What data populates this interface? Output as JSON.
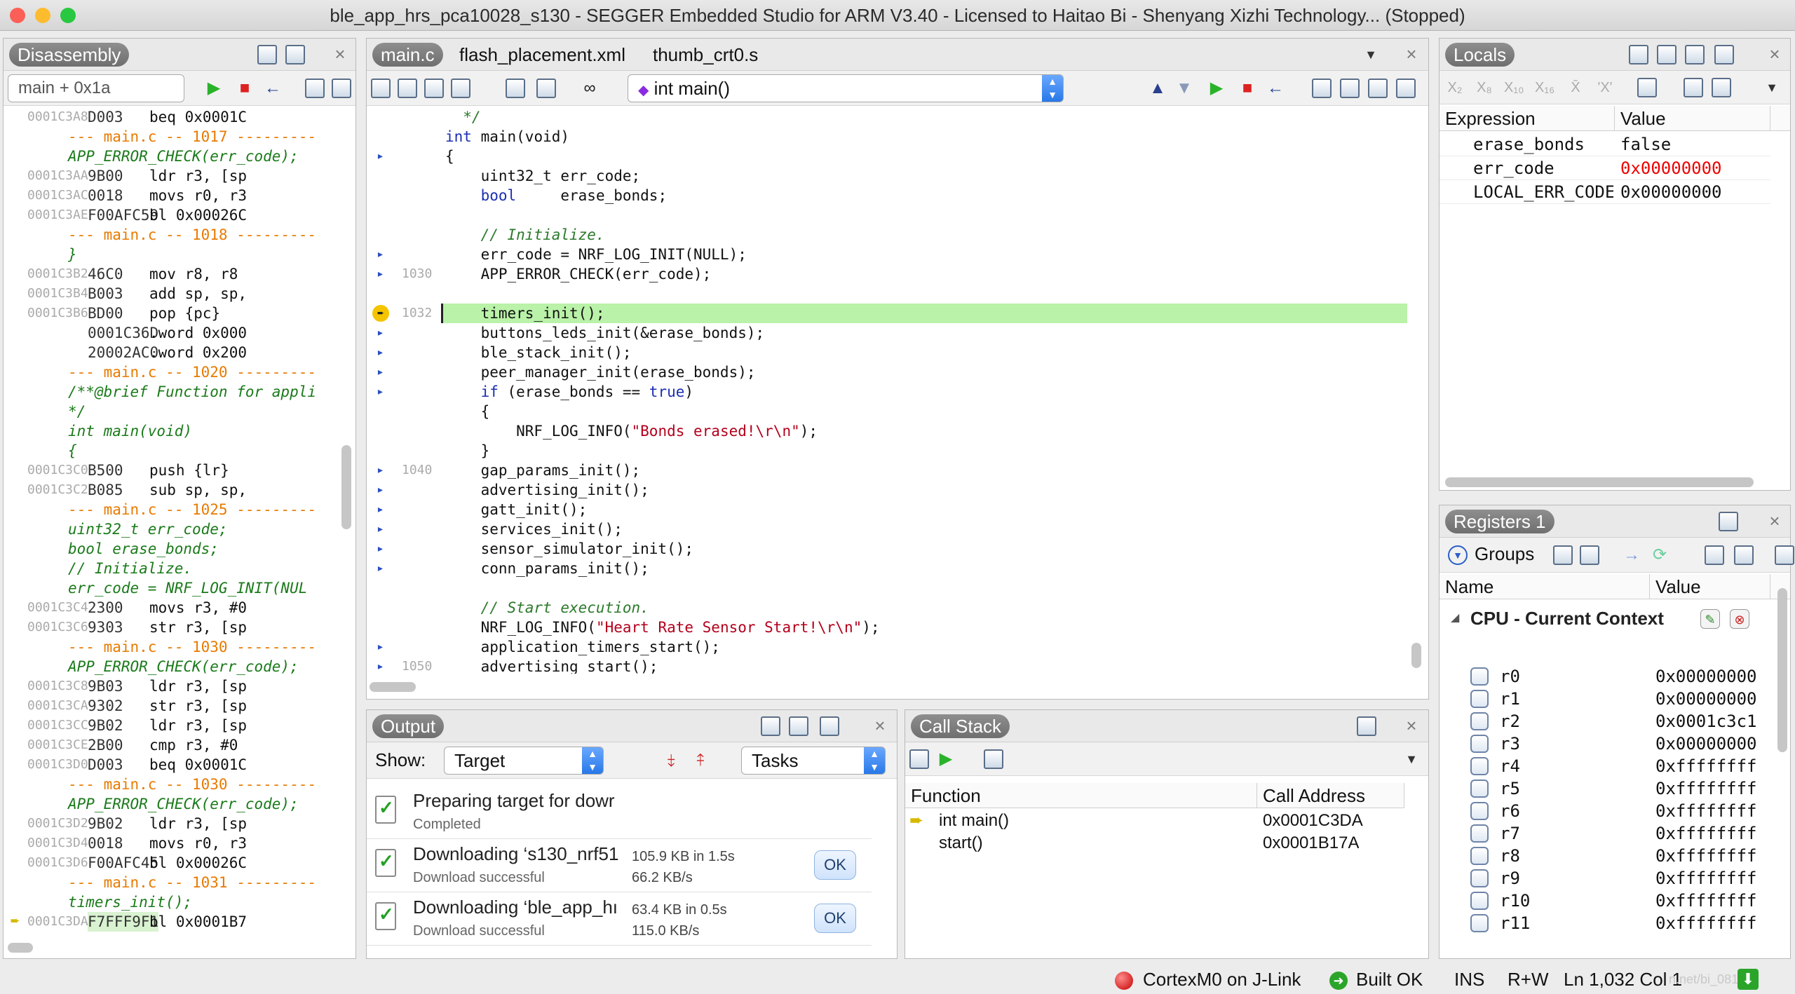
{
  "window": {
    "title": "ble_app_hrs_pca10028_s130 - SEGGER Embedded Studio for ARM V3.40 - Licensed to Haitao Bi - Shenyang Xizhi Technology... (Stopped)"
  },
  "disassembly": {
    "title": "Disassembly",
    "location": "main + 0x1a",
    "rows": [
      {
        "t": "i",
        "addr": "0001C3A8",
        "bytes": "D003",
        "text": "beq 0x0001C"
      },
      {
        "t": "s",
        "text": "--- main.c -- 1017 ---------"
      },
      {
        "t": "c",
        "text": "APP_ERROR_CHECK(err_code);"
      },
      {
        "t": "i",
        "addr": "0001C3AA",
        "bytes": "9B00",
        "text": "ldr r3, [sp"
      },
      {
        "t": "i",
        "addr": "0001C3AC",
        "bytes": "0018",
        "text": "movs r0, r3"
      },
      {
        "t": "i",
        "addr": "0001C3AE",
        "bytes": "F00AFC59",
        "text": "bl 0x00026C"
      },
      {
        "t": "s",
        "text": "--- main.c -- 1018 ---------"
      },
      {
        "t": "c",
        "text": "}"
      },
      {
        "t": "i",
        "addr": "0001C3B2",
        "bytes": "46C0",
        "text": "mov r8, r8"
      },
      {
        "t": "i",
        "addr": "0001C3B4",
        "bytes": "B003",
        "text": "add sp, sp,"
      },
      {
        "t": "i",
        "addr": "0001C3B6",
        "bytes": "BD00",
        "text": "pop {pc}"
      },
      {
        "t": "i",
        "addr": "",
        "bytes": "0001C36D",
        "text": ".word 0x000"
      },
      {
        "t": "i",
        "addr": "",
        "bytes": "20002AC0",
        "text": ".word 0x200"
      },
      {
        "t": "s",
        "text": "--- main.c -- 1020 ---------"
      },
      {
        "t": "c",
        "text": "/**@brief Function for appli"
      },
      {
        "t": "c",
        "text": "*/"
      },
      {
        "t": "c",
        "text": "int main(void)"
      },
      {
        "t": "c",
        "text": "{"
      },
      {
        "t": "i",
        "addr": "0001C3C0",
        "bytes": "B500",
        "text": "push {lr}"
      },
      {
        "t": "i",
        "addr": "0001C3C2",
        "bytes": "B085",
        "text": "sub sp, sp,"
      },
      {
        "t": "s",
        "text": "--- main.c -- 1025 ---------"
      },
      {
        "t": "c",
        "text": "uint32_t err_code;"
      },
      {
        "t": "c",
        "text": "bool erase_bonds;"
      },
      {
        "t": "c",
        "text": "// Initialize."
      },
      {
        "t": "c",
        "text": "err_code = NRF_LOG_INIT(NUL"
      },
      {
        "t": "i",
        "addr": "0001C3C4",
        "bytes": "2300",
        "text": "movs r3, #0"
      },
      {
        "t": "i",
        "addr": "0001C3C6",
        "bytes": "9303",
        "text": "str r3, [sp"
      },
      {
        "t": "s",
        "text": "--- main.c -- 1030 ---------"
      },
      {
        "t": "c",
        "text": "APP_ERROR_CHECK(err_code);"
      },
      {
        "t": "i",
        "addr": "0001C3C8",
        "bytes": "9B03",
        "text": "ldr r3, [sp"
      },
      {
        "t": "i",
        "addr": "0001C3CA",
        "bytes": "9302",
        "text": "str r3, [sp"
      },
      {
        "t": "i",
        "addr": "0001C3CC",
        "bytes": "9B02",
        "text": "ldr r3, [sp"
      },
      {
        "t": "i",
        "addr": "0001C3CE",
        "bytes": "2B00",
        "text": "cmp r3, #0"
      },
      {
        "t": "i",
        "addr": "0001C3D0",
        "bytes": "D003",
        "text": "beq 0x0001C"
      },
      {
        "t": "s",
        "text": "--- main.c -- 1030 ---------"
      },
      {
        "t": "c",
        "text": "APP_ERROR_CHECK(err_code);"
      },
      {
        "t": "i",
        "addr": "0001C3D2",
        "bytes": "9B02",
        "text": "ldr r3, [sp"
      },
      {
        "t": "i",
        "addr": "0001C3D4",
        "bytes": "0018",
        "text": "movs r0, r3"
      },
      {
        "t": "i",
        "addr": "0001C3D6",
        "bytes": "F00AFC45",
        "text": "bl 0x00026C"
      },
      {
        "t": "s",
        "text": "--- main.c -- 1031 ---------"
      },
      {
        "t": "c",
        "text": "timers_init();"
      },
      {
        "t": "i",
        "addr": "0001C3DA",
        "bytes": "F7FFF9F1",
        "text": "bl 0x0001B7",
        "current": true
      }
    ]
  },
  "editor": {
    "tabs": [
      "main.c",
      "flash_placement.xml",
      "thumb_crt0.s"
    ],
    "function_selector": "int main()",
    "lines": [
      {
        "n": "",
        "m": "",
        "parts": [
          [
            "cmt",
            "  */"
          ]
        ]
      },
      {
        "n": "",
        "m": "",
        "parts": [
          [
            "kw",
            "int"
          ],
          [
            "code",
            " main(void)"
          ]
        ]
      },
      {
        "n": "",
        "m": "arrow",
        "parts": [
          [
            "code",
            "{"
          ]
        ]
      },
      {
        "n": "",
        "m": "",
        "parts": [
          [
            "code",
            "    uint32_t err_code;"
          ]
        ]
      },
      {
        "n": "",
        "m": "",
        "parts": [
          [
            "kw",
            "    bool"
          ],
          [
            "code",
            "     erase_bonds;"
          ]
        ]
      },
      {
        "n": "",
        "m": "",
        "parts": [
          [
            "code",
            ""
          ]
        ]
      },
      {
        "n": "",
        "m": "",
        "parts": [
          [
            "cmt",
            "    // Initialize."
          ]
        ]
      },
      {
        "n": "",
        "m": "arrow",
        "parts": [
          [
            "code",
            "    err_code = NRF_LOG_INIT(NULL);"
          ]
        ]
      },
      {
        "n": "1030",
        "m": "arrow",
        "parts": [
          [
            "code",
            "    APP_ERROR_CHECK(err_code);"
          ]
        ]
      },
      {
        "n": "",
        "m": "",
        "parts": [
          [
            "code",
            ""
          ]
        ]
      },
      {
        "n": "1032",
        "m": "current",
        "parts": [
          [
            "code",
            "    timers_init();"
          ]
        ]
      },
      {
        "n": "",
        "m": "arrow",
        "parts": [
          [
            "code",
            "    buttons_leds_init(&erase_bonds);"
          ]
        ]
      },
      {
        "n": "",
        "m": "arrow",
        "parts": [
          [
            "code",
            "    ble_stack_init();"
          ]
        ]
      },
      {
        "n": "",
        "m": "arrow",
        "parts": [
          [
            "code",
            "    peer_manager_init(erase_bonds);"
          ]
        ]
      },
      {
        "n": "",
        "m": "arrow",
        "parts": [
          [
            "kw",
            "    if"
          ],
          [
            "code",
            " (erase_bonds == "
          ],
          [
            "kw",
            "true"
          ],
          [
            "code",
            ")"
          ]
        ]
      },
      {
        "n": "",
        "m": "",
        "parts": [
          [
            "code",
            "    {"
          ]
        ]
      },
      {
        "n": "",
        "m": "",
        "parts": [
          [
            "code",
            "        NRF_LOG_INFO("
          ],
          [
            "str",
            "\"Bonds erased!\\r\\n\""
          ],
          [
            "code",
            ");"
          ]
        ]
      },
      {
        "n": "",
        "m": "",
        "parts": [
          [
            "code",
            "    }"
          ]
        ]
      },
      {
        "n": "1040",
        "m": "arrow",
        "parts": [
          [
            "code",
            "    gap_params_init();"
          ]
        ]
      },
      {
        "n": "",
        "m": "arrow",
        "parts": [
          [
            "code",
            "    advertising_init();"
          ]
        ]
      },
      {
        "n": "",
        "m": "arrow",
        "parts": [
          [
            "code",
            "    gatt_init();"
          ]
        ]
      },
      {
        "n": "",
        "m": "arrow",
        "parts": [
          [
            "code",
            "    services_init();"
          ]
        ]
      },
      {
        "n": "",
        "m": "arrow",
        "parts": [
          [
            "code",
            "    sensor_simulator_init();"
          ]
        ]
      },
      {
        "n": "",
        "m": "arrow",
        "parts": [
          [
            "code",
            "    conn_params_init();"
          ]
        ]
      },
      {
        "n": "",
        "m": "",
        "parts": [
          [
            "code",
            ""
          ]
        ]
      },
      {
        "n": "",
        "m": "",
        "parts": [
          [
            "cmt",
            "    // Start execution."
          ]
        ]
      },
      {
        "n": "",
        "m": "",
        "parts": [
          [
            "code",
            "    NRF_LOG_INFO("
          ],
          [
            "str",
            "\"Heart Rate Sensor Start!\\r\\n\""
          ],
          [
            "code",
            ");"
          ]
        ]
      },
      {
        "n": "",
        "m": "arrow",
        "parts": [
          [
            "code",
            "    application_timers_start();"
          ]
        ]
      },
      {
        "n": "1050",
        "m": "arrow",
        "parts": [
          [
            "code",
            "    advertising_start();"
          ]
        ]
      }
    ]
  },
  "locals": {
    "title": "Locals",
    "columns": [
      "Expression",
      "Value"
    ],
    "rows": [
      {
        "name": "erase_bonds",
        "value": "false",
        "changed": false
      },
      {
        "name": "err_code",
        "value": "0x00000000",
        "changed": true
      },
      {
        "name": "LOCAL_ERR_CODE",
        "value": "0x00000000",
        "changed": false
      }
    ]
  },
  "registers": {
    "title": "Registers 1",
    "groups_label": "Groups",
    "columns": [
      "Name",
      "Value"
    ],
    "group_title": "CPU - Current Context",
    "rows": [
      {
        "name": "r0",
        "value": "0x00000000"
      },
      {
        "name": "r1",
        "value": "0x00000000"
      },
      {
        "name": "r2",
        "value": "0x0001c3c1"
      },
      {
        "name": "r3",
        "value": "0x00000000"
      },
      {
        "name": "r4",
        "value": "0xffffffff"
      },
      {
        "name": "r5",
        "value": "0xffffffff"
      },
      {
        "name": "r6",
        "value": "0xffffffff"
      },
      {
        "name": "r7",
        "value": "0xffffffff"
      },
      {
        "name": "r8",
        "value": "0xffffffff"
      },
      {
        "name": "r9",
        "value": "0xffffffff"
      },
      {
        "name": "r10",
        "value": "0xffffffff"
      },
      {
        "name": "r11",
        "value": "0xffffffff"
      }
    ]
  },
  "output": {
    "title": "Output",
    "show_label": "Show:",
    "show_value": "Target",
    "tasks_value": "Tasks",
    "items": [
      {
        "title": "Preparing target for dowr",
        "sub": "Completed",
        "stats1": "",
        "stats2": "",
        "ok": ""
      },
      {
        "title": "Downloading ‘s130_nrf51",
        "sub": "Download successful",
        "stats1": "105.9 KB in 1.5s",
        "stats2": "66.2 KB/s",
        "ok": "OK"
      },
      {
        "title": "Downloading ‘ble_app_hı",
        "sub": "Download successful",
        "stats1": "63.4 KB in 0.5s",
        "stats2": "115.0 KB/s",
        "ok": "OK"
      }
    ]
  },
  "callstack": {
    "title": "Call Stack",
    "columns": [
      "Function",
      "Call Address"
    ],
    "rows": [
      {
        "fn": "int main()",
        "addr": "0x0001C3DA",
        "current": true
      },
      {
        "fn": "start()",
        "addr": "0x0001B17A",
        "current": false
      }
    ]
  },
  "status": {
    "target": "CortexM0 on J-Link",
    "build": "Built OK",
    "mode": "INS",
    "access": "R+W",
    "position": "Ln 1,032 Col 1",
    "watermark": "n.net/bi_0814"
  }
}
